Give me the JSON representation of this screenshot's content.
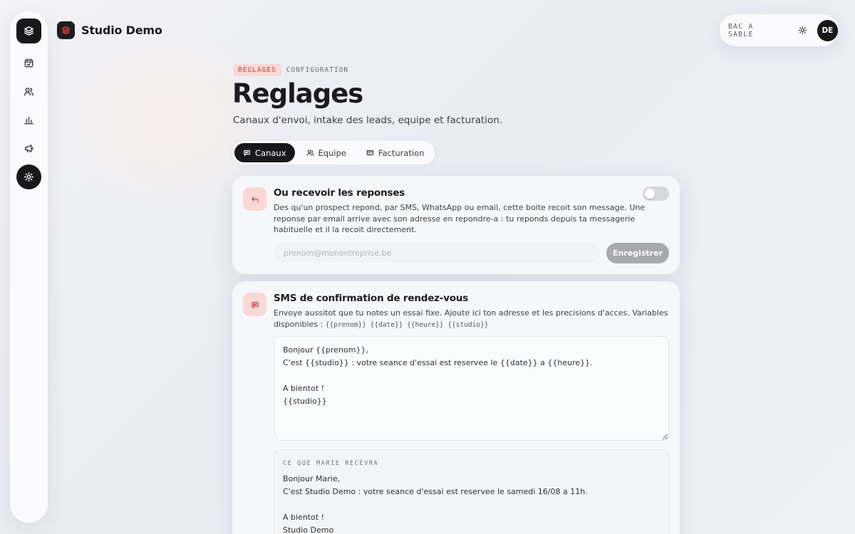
{
  "brand": {
    "name": "Studio Demo"
  },
  "topbar": {
    "sandbox_label": "BAC A SABLE",
    "avatar_initials": "DE"
  },
  "sidebar": {
    "items": [
      {
        "icon": "layers-icon"
      },
      {
        "icon": "calendar-icon"
      },
      {
        "icon": "users-icon"
      },
      {
        "icon": "bar-chart-icon"
      },
      {
        "icon": "megaphone-icon"
      },
      {
        "icon": "gear-icon",
        "active": true
      }
    ]
  },
  "header": {
    "crumb_tag": "REGLAGES",
    "crumb_sub": "CONFIGURATION",
    "title": "Reglages",
    "subtitle": "Canaux d'envoi, intake des leads, equipe et facturation."
  },
  "tabs": [
    {
      "label": "Canaux",
      "icon": "message-icon",
      "active": true
    },
    {
      "label": "Equipe",
      "icon": "users-icon"
    },
    {
      "label": "Facturation",
      "icon": "card-icon"
    }
  ],
  "reply_card": {
    "title": "Ou recevoir les reponses",
    "description": "Des qu'un prospect repond, par SMS, WhatsApp ou email, cette boite recoit son message. Une reponse par email arrive avec son adresse en repondre-a : tu reponds depuis ta messagerie habituelle et il la recoit directement.",
    "email_placeholder": "prenom@monentreprise.be",
    "email_value": "",
    "save_label": "Enregistrer",
    "toggle_on": false
  },
  "sms_card": {
    "title": "SMS de confirmation de rendez-vous",
    "description": "Envoye aussitot que tu notes un essai fixe. Ajoute ici ton adresse et les precisions d'acces. Variables disponibles :",
    "variables": "{{prenom}} {{date}} {{heure}} {{studio}}",
    "template_text": "Bonjour {{prenom}},\nC'est {{studio}} : votre seance d'essai est reservee le {{date}} a {{heure}}.\n\nA bientot !\n{{studio}}",
    "preview_label": "CE QUE MARIE RECEVRA",
    "preview_lines": [
      "Bonjour Marie,",
      "C'est Studio Demo : votre seance d'essai est reservee le samedi 16/08 a 11h.",
      "",
      "A bientot !",
      "Studio Demo"
    ]
  }
}
